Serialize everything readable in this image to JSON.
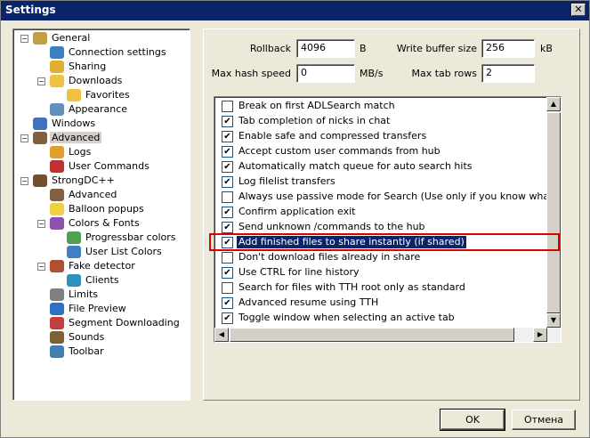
{
  "window": {
    "title": "Settings"
  },
  "tree": [
    {
      "label": "General",
      "level": 0,
      "icon": "gear-icon"
    },
    {
      "label": "Connection settings",
      "level": 1,
      "icon": "network-icon"
    },
    {
      "label": "Sharing",
      "level": 1,
      "icon": "folder-share-icon"
    },
    {
      "label": "Downloads",
      "level": 1,
      "icon": "folder-icon"
    },
    {
      "label": "Favorites",
      "level": 2,
      "icon": "folder-icon"
    },
    {
      "label": "Appearance",
      "level": 1,
      "icon": "palette-icon"
    },
    {
      "label": "Windows",
      "level": 0,
      "icon": "window-icon"
    },
    {
      "label": "Advanced",
      "level": 0,
      "icon": "advanced-icon",
      "selected": true
    },
    {
      "label": "Logs",
      "level": 1,
      "icon": "log-icon"
    },
    {
      "label": "User Commands",
      "level": 1,
      "icon": "command-icon"
    },
    {
      "label": "StrongDC++",
      "level": 0,
      "icon": "app-icon"
    },
    {
      "label": "Advanced",
      "level": 1,
      "icon": "advanced-icon"
    },
    {
      "label": "Balloon popups",
      "level": 1,
      "icon": "balloon-icon"
    },
    {
      "label": "Colors & Fonts",
      "level": 1,
      "icon": "colors-icon"
    },
    {
      "label": "Progressbar colors",
      "level": 2,
      "icon": "progressbar-icon"
    },
    {
      "label": "User List Colors",
      "level": 2,
      "icon": "userlist-icon"
    },
    {
      "label": "Fake detector",
      "level": 1,
      "icon": "detector-icon"
    },
    {
      "label": "Clients",
      "level": 2,
      "icon": "clients-icon"
    },
    {
      "label": "Limits",
      "level": 1,
      "icon": "limits-icon"
    },
    {
      "label": "File Preview",
      "level": 1,
      "icon": "preview-icon"
    },
    {
      "label": "Segment Downloading",
      "level": 1,
      "icon": "segment-icon"
    },
    {
      "label": "Sounds",
      "level": 1,
      "icon": "sound-icon"
    },
    {
      "label": "Toolbar",
      "level": 1,
      "icon": "toolbar-icon"
    }
  ],
  "fields": {
    "rollback_label": "Rollback",
    "rollback_value": "4096",
    "rollback_unit": "B",
    "write_buffer_label": "Write buffer size",
    "write_buffer_value": "256",
    "write_buffer_unit": "kB",
    "max_hash_label": "Max hash speed",
    "max_hash_value": "0",
    "max_hash_unit": "MB/s",
    "max_tab_label": "Max tab rows",
    "max_tab_value": "2"
  },
  "options": [
    {
      "label": "Break on first ADLSearch match",
      "checked": false
    },
    {
      "label": "Tab completion of nicks in chat",
      "checked": true
    },
    {
      "label": "Enable safe and compressed transfers",
      "checked": true
    },
    {
      "label": "Accept custom user commands from hub",
      "checked": true
    },
    {
      "label": "Automatically match queue for auto search hits",
      "checked": true
    },
    {
      "label": "Log filelist transfers",
      "checked": true
    },
    {
      "label": "Always use passive mode for Search (Use only if you know what this doi",
      "checked": false
    },
    {
      "label": "Confirm application exit",
      "checked": true
    },
    {
      "label": "Send unknown /commands to the hub",
      "checked": true
    },
    {
      "label": "Add finished files to share instantly (if shared)",
      "checked": true,
      "highlighted": true
    },
    {
      "label": "Don't download files already in share",
      "checked": false
    },
    {
      "label": "Use CTRL for line history",
      "checked": true
    },
    {
      "label": "Search for files with TTH root only as standard",
      "checked": false
    },
    {
      "label": "Advanced resume using TTH",
      "checked": true
    },
    {
      "label": "Toggle window when selecting an active tab",
      "checked": true
    }
  ],
  "buttons": {
    "ok": "OK",
    "cancel": "Отмена",
    "close": "✕"
  }
}
